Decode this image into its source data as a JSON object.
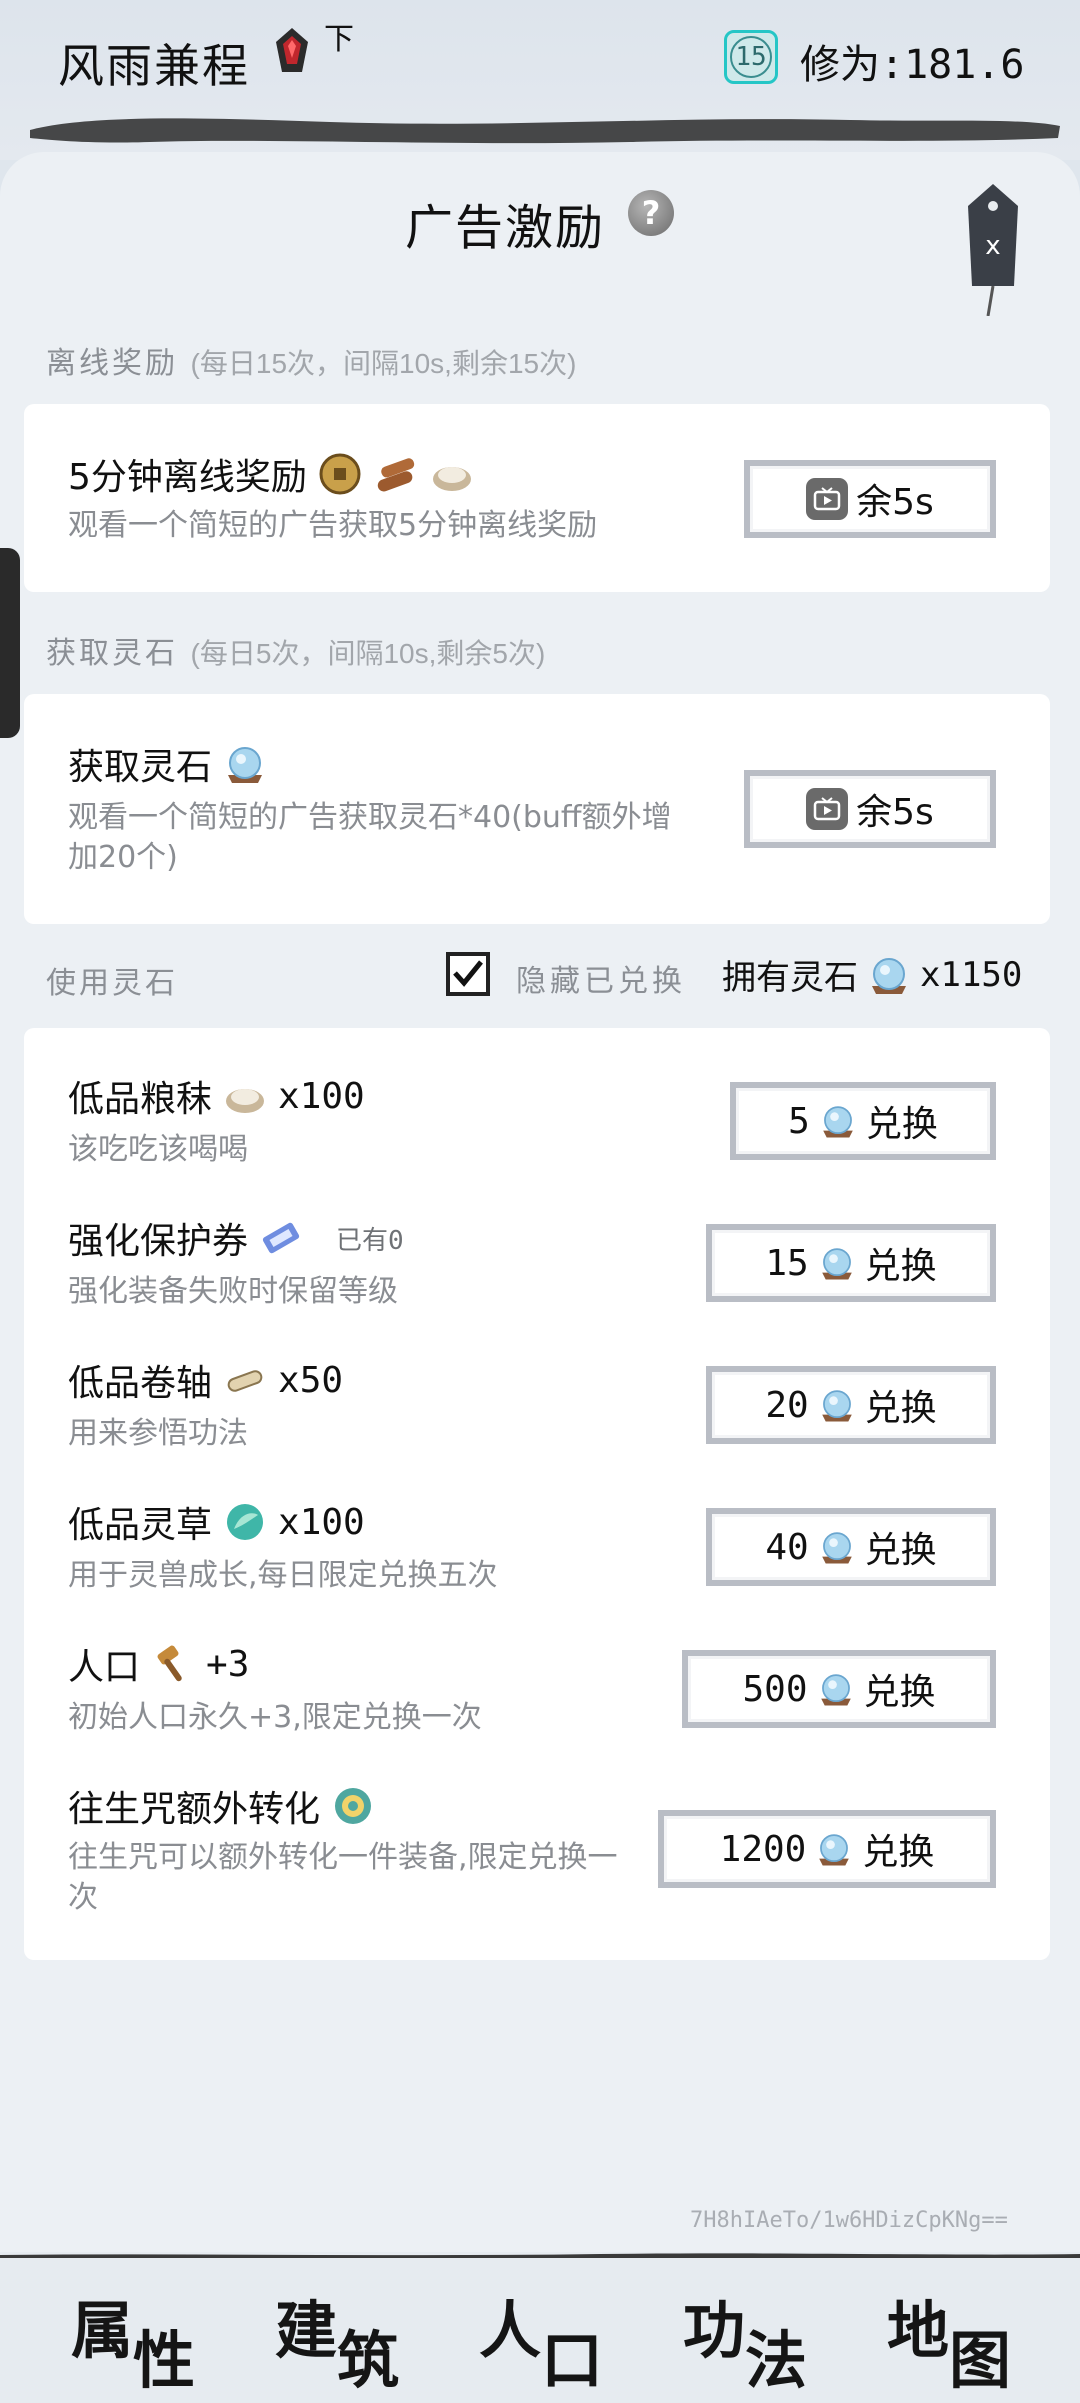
{
  "header": {
    "player_name": "风雨兼程",
    "realm_sub": "下",
    "level": "15",
    "cultivation": "修为:181.6"
  },
  "panel": {
    "title": "广告激励",
    "close_label": "x"
  },
  "offline_section": {
    "label": "离线奖励",
    "note": "(每日15次，间隔10s,剩余15次)",
    "item": {
      "title": "5分钟离线奖励",
      "desc": "观看一个简短的广告获取5分钟离线奖励",
      "button": "余5s"
    }
  },
  "stone_section": {
    "label": "获取灵石",
    "note": "(每日5次，间隔10s,剩余5次)",
    "item": {
      "title": "获取灵石",
      "desc_line1": "观看一个简短的广告获取灵石*40(buff额外增",
      "desc_line2": "加20个)",
      "button": "余5s"
    }
  },
  "use_section": {
    "label": "使用灵石",
    "hide_label": "隐藏已兑换",
    "hide_checked": true,
    "owned_label": "拥有灵石",
    "owned_value": "x1150"
  },
  "exchange_items": [
    {
      "title": "低品粮秣",
      "qty": "x100",
      "owned": "",
      "desc_line1": "该吃吃该喝喝",
      "desc_line2": "",
      "cost": "5",
      "action": "兑换",
      "icon": "grain-icon"
    },
    {
      "title": "强化保护券",
      "qty": "",
      "owned": "已有0",
      "desc_line1": "强化装备失败时保留等级",
      "desc_line2": "",
      "cost": "15",
      "action": "兑换",
      "icon": "ticket-icon"
    },
    {
      "title": "低品卷轴",
      "qty": "x50",
      "owned": "",
      "desc_line1": "用来参悟功法",
      "desc_line2": "",
      "cost": "20",
      "action": "兑换",
      "icon": "scroll-icon"
    },
    {
      "title": "低品灵草",
      "qty": "x100",
      "owned": "",
      "desc_line1": "用于灵兽成长,每日限定兑换五次",
      "desc_line2": "",
      "cost": "40",
      "action": "兑换",
      "icon": "herb-icon"
    },
    {
      "title": "人口",
      "qty": "+3",
      "owned": "",
      "desc_line1": "初始人口永久+3,限定兑换一次",
      "desc_line2": "",
      "cost": "500",
      "action": "兑换",
      "icon": "hammer-icon"
    },
    {
      "title": "往生咒额外转化",
      "qty": "",
      "owned": "",
      "desc_line1": "往生咒可以额外转化一件装备,限定兑换一",
      "desc_line2": "次",
      "cost": "1200",
      "action": "兑换",
      "icon": "talisman-icon"
    }
  ],
  "watermark": "7H8hIAeTo/1w6HDizCpKNg==",
  "bottom_nav": [
    {
      "c1": "属",
      "c2": "性"
    },
    {
      "c1": "建",
      "c2": "筑"
    },
    {
      "c1": "人",
      "c2": "口"
    },
    {
      "c1": "功",
      "c2": "法"
    },
    {
      "c1": "地",
      "c2": "图"
    }
  ],
  "colors": {
    "background": "#dfe6ed",
    "panel": "#ecf0f4",
    "card": "#ffffff",
    "button_border": "#b9bdc5",
    "muted_text": "#8a8d92",
    "level_accent": "#25c6c6"
  }
}
